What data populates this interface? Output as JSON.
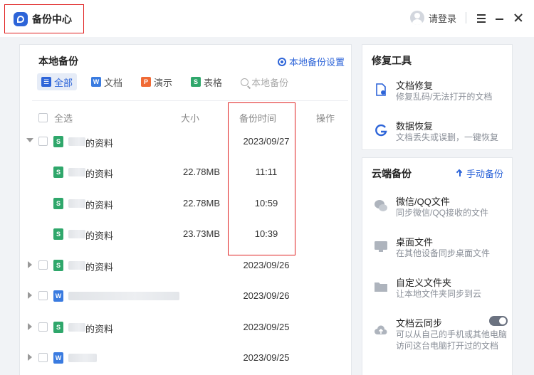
{
  "app": {
    "title": "备份中心",
    "login_label": "请登录"
  },
  "colors": {
    "accent": "#2d64d8",
    "highlight": "#e02020",
    "sheet": "#2fa76b",
    "word": "#3a7be0",
    "ppt": "#f06a35"
  },
  "main": {
    "title": "本地备份",
    "settings_label": "本地备份设置",
    "filters": [
      {
        "label": "全部",
        "icon": "list-icon"
      },
      {
        "label": "文档",
        "icon": "word-icon"
      },
      {
        "label": "演示",
        "icon": "ppt-icon"
      },
      {
        "label": "表格",
        "icon": "sheet-icon"
      }
    ],
    "search_placeholder": "本地备份",
    "columns": {
      "select_all": "全选",
      "size": "大小",
      "time": "备份时间",
      "action": "操作"
    },
    "rows": [
      {
        "name": "的资料",
        "size": "",
        "time": "2023/09/27",
        "type": "sheet",
        "expanded": true,
        "child": false
      },
      {
        "name": "的资料",
        "size": "22.78MB",
        "time": "11:11",
        "type": "sheet",
        "child": true
      },
      {
        "name": "的资料",
        "size": "22.78MB",
        "time": "10:59",
        "type": "sheet",
        "child": true
      },
      {
        "name": "的资料",
        "size": "23.73MB",
        "time": "10:39",
        "type": "sheet",
        "child": true
      },
      {
        "name": "的资料",
        "size": "",
        "time": "2023/09/26",
        "type": "sheet",
        "child": false
      },
      {
        "name": "",
        "size": "",
        "time": "2023/09/26",
        "type": "word",
        "child": false
      },
      {
        "name": "的资料",
        "size": "",
        "time": "2023/09/25",
        "type": "sheet",
        "child": false
      },
      {
        "name": "",
        "size": "",
        "time": "2023/09/25",
        "type": "word",
        "child": false
      }
    ]
  },
  "repair": {
    "title": "修复工具",
    "items": [
      {
        "name": "文档修复",
        "desc": "修复乱码/无法打开的文档",
        "icon": "document-repair-icon"
      },
      {
        "name": "数据恢复",
        "desc": "文档丢失或误删，一键恢复",
        "icon": "data-recovery-icon"
      }
    ]
  },
  "cloud": {
    "title": "云端备份",
    "manual_label": "手动备份",
    "items": [
      {
        "name": "微信/QQ文件",
        "desc": "同步微信/QQ接收的文件",
        "icon": "chat-icon"
      },
      {
        "name": "桌面文件",
        "desc": "在其他设备同步桌面文件",
        "icon": "desktop-icon"
      },
      {
        "name": "自定义文件夹",
        "desc": "让本地文件夹同步到云",
        "icon": "folder-icon"
      },
      {
        "name": "文档云同步",
        "desc": "可以从自己的手机或其他电脑",
        "desc2": "访问这台电脑打开过的文档",
        "icon": "cloud-sync-icon"
      }
    ]
  }
}
